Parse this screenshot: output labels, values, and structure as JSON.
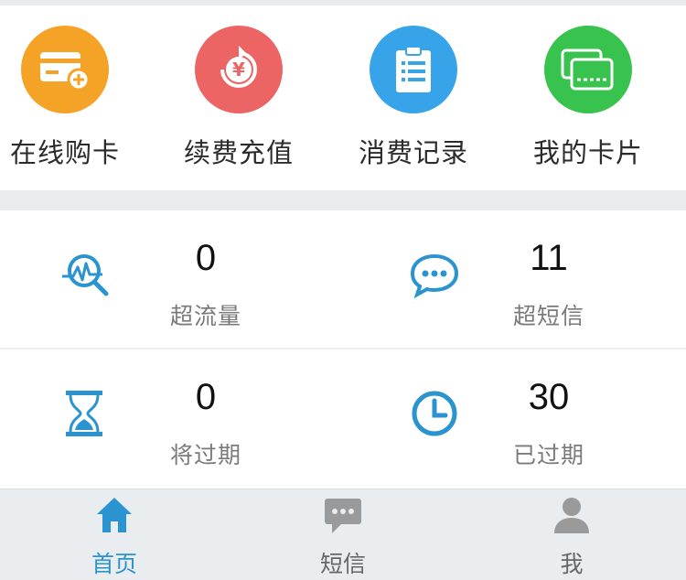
{
  "quick_actions": [
    {
      "label": "在线购卡",
      "icon": "card-add-icon",
      "color": "#f5a327"
    },
    {
      "label": "续费充值",
      "icon": "yuan-recharge-icon",
      "color": "#ec6464"
    },
    {
      "label": "消费记录",
      "icon": "clipboard-record-icon",
      "color": "#37a4ea"
    },
    {
      "label": "我的卡片",
      "icon": "cards-icon",
      "color": "#38c24e"
    }
  ],
  "stats": [
    {
      "value": "0",
      "label": "超流量",
      "icon": "traffic-chart-icon"
    },
    {
      "value": "11",
      "label": "超短信",
      "icon": "message-bubble-icon"
    },
    {
      "value": "0",
      "label": "将过期",
      "icon": "hourglass-icon"
    },
    {
      "value": "30",
      "label": "已过期",
      "icon": "clock-icon"
    }
  ],
  "tabs": [
    {
      "label": "首页",
      "icon": "home-icon",
      "active": true
    },
    {
      "label": "短信",
      "icon": "chat-icon",
      "active": false
    },
    {
      "label": "我",
      "icon": "user-icon",
      "active": false
    }
  ],
  "colors": {
    "accent": "#2b93cf",
    "tab_inactive": "#9a9a9a"
  }
}
